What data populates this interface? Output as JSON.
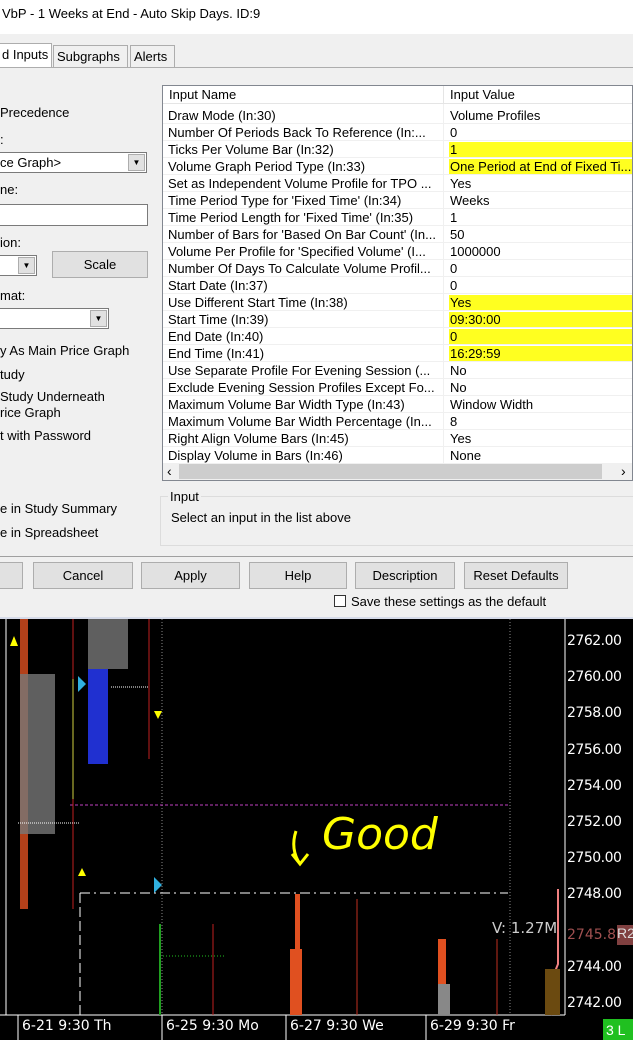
{
  "window": {
    "title": "VbP - 1 Weeks at End - Auto Skip Days. ID:9"
  },
  "tabs": [
    "d Inputs",
    "Subgraphs",
    "Alerts"
  ],
  "left": {
    "precedence": "Precedence",
    "colon": ":",
    "graph_combo": "ce Graph>",
    "name_label": "ne:",
    "name_value": "",
    "region_label": "ion:",
    "region_combo": "",
    "scale_button": "Scale",
    "format_label": "mat:",
    "format_combo": "",
    "opts": [
      "y As Main Price Graph",
      "tudy",
      "Study Underneath",
      "rice Graph",
      "t with Password"
    ],
    "summary": "e in Study Summary",
    "spreadsheet": "e in Spreadsheet"
  },
  "inputs": {
    "headers": [
      "Input Name",
      "Input Value"
    ],
    "rows": [
      {
        "name": "Draw Mode   (In:30)",
        "value": "Volume Profiles"
      },
      {
        "name": "Number Of Periods Back To Reference   (In:...",
        "value": "0"
      },
      {
        "name": "Ticks Per Volume Bar   (In:32)",
        "value": "1",
        "hl": true
      },
      {
        "name": "Volume Graph Period Type   (In:33)",
        "value": "One Period at End of Fixed Ti...",
        "hl": true
      },
      {
        "name": "Set as Independent Volume Profile for TPO ...",
        "value": "Yes"
      },
      {
        "name": "Time Period Type for 'Fixed Time'   (In:34)",
        "value": "Weeks"
      },
      {
        "name": "Time Period Length for 'Fixed Time'   (In:35)",
        "value": "1"
      },
      {
        "name": "Number of Bars for 'Based On Bar Count'   (In...",
        "value": "50"
      },
      {
        "name": "Volume Per Profile for 'Specified Volume'   (I...",
        "value": "1000000"
      },
      {
        "name": "Number Of Days To Calculate Volume Profil...",
        "value": "0"
      },
      {
        "name": "Start Date   (In:37)",
        "value": "0"
      },
      {
        "name": "Use Different Start Time   (In:38)",
        "value": "Yes",
        "hl": true
      },
      {
        "name": "Start Time   (In:39)",
        "value": "09:30:00",
        "hl": true
      },
      {
        "name": "End Date   (In:40)",
        "value": "0",
        "hl": true
      },
      {
        "name": "End Time   (In:41)",
        "value": "16:29:59",
        "hl": true
      },
      {
        "name": "Use Separate Profile For Evening Session   (...",
        "value": "No"
      },
      {
        "name": "Exclude Evening Session Profiles Except Fo...",
        "value": "No"
      },
      {
        "name": "Maximum Volume Bar Width Type   (In:43)",
        "value": "Window Width"
      },
      {
        "name": "Maximum Volume Bar Width Percentage   (In...",
        "value": "8"
      },
      {
        "name": "Right Align Volume Bars   (In:45)",
        "value": "Yes"
      },
      {
        "name": "Display Volume in Bars   (In:46)",
        "value": "None"
      }
    ],
    "scroll_left": "‹",
    "scroll_right": "›"
  },
  "input_group": {
    "title": "Input",
    "hint": "Select an input in the list above"
  },
  "buttons": {
    "ok": "",
    "cancel": "Cancel",
    "apply": "Apply",
    "help": "Help",
    "description": "Description",
    "reset": "Reset Defaults"
  },
  "save_default": "Save these settings as the default",
  "chart": {
    "prices": [
      "2762.00",
      "2760.00",
      "2758.00",
      "2756.00",
      "2754.00",
      "2752.00",
      "2750.00",
      "2748.00",
      "2744.00",
      "2742.00"
    ],
    "current_price": "2745.8",
    "current_tag": "R2",
    "volume_label": "V: 1.27M",
    "times": [
      "6-21  9:30 Th",
      "6-25  9:30 Mo",
      "6-27  9:30 We",
      "6-29  9:30 Fr"
    ],
    "status": "3 L",
    "annotation": "Good",
    "highlight_color": "#ffff20"
  }
}
